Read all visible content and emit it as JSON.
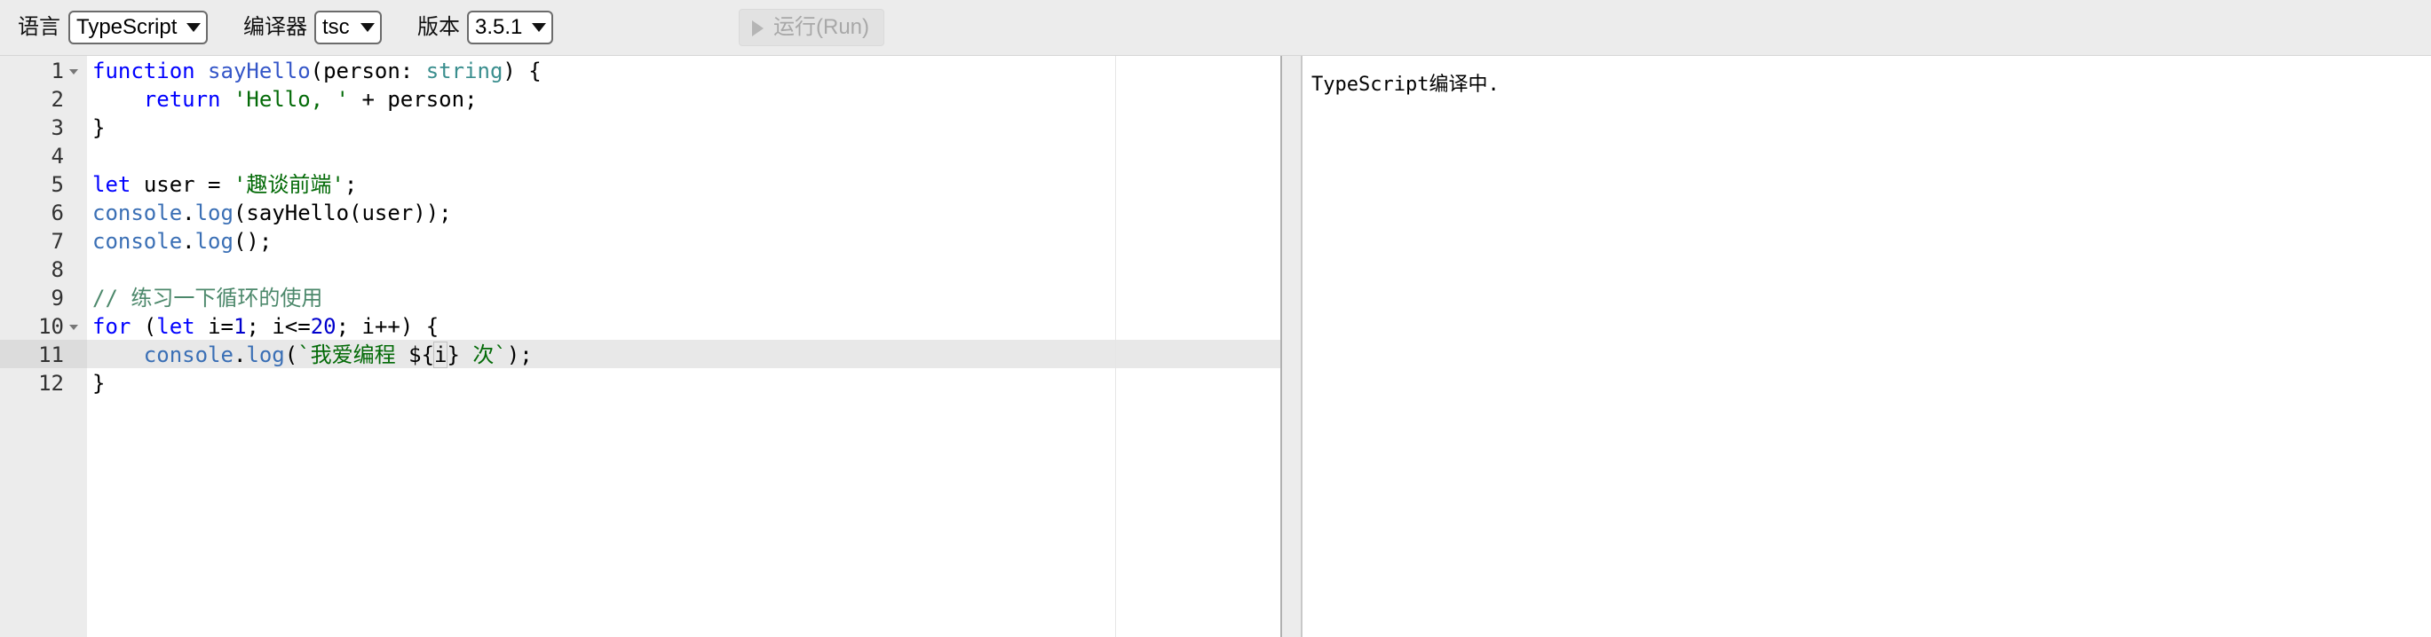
{
  "toolbar": {
    "language_label": "语言",
    "language_value": "TypeScript",
    "compiler_label": "编译器",
    "compiler_value": "tsc",
    "version_label": "版本",
    "version_value": "3.5.1",
    "run_label": "运行(Run)"
  },
  "editor": {
    "language": "typescript",
    "active_line": 11,
    "lines": [
      {
        "num": "1",
        "fold": true,
        "text": "function sayHello(person: string) {"
      },
      {
        "num": "2",
        "fold": false,
        "text": "    return 'Hello, ' + person;"
      },
      {
        "num": "3",
        "fold": false,
        "text": "}"
      },
      {
        "num": "4",
        "fold": false,
        "text": ""
      },
      {
        "num": "5",
        "fold": false,
        "text": "let user = '趣谈前端';"
      },
      {
        "num": "6",
        "fold": false,
        "text": "console.log(sayHello(user));"
      },
      {
        "num": "7",
        "fold": false,
        "text": "console.log();"
      },
      {
        "num": "8",
        "fold": false,
        "text": ""
      },
      {
        "num": "9",
        "fold": false,
        "text": "// 练习一下循环的使用"
      },
      {
        "num": "10",
        "fold": true,
        "text": "for (let i=1; i<=20; i++) {"
      },
      {
        "num": "11",
        "fold": false,
        "text": "    console.log(`我爱编程 ${i} 次`);"
      },
      {
        "num": "12",
        "fold": false,
        "text": "}"
      }
    ]
  },
  "output": {
    "text": "TypeScript编译中."
  }
}
